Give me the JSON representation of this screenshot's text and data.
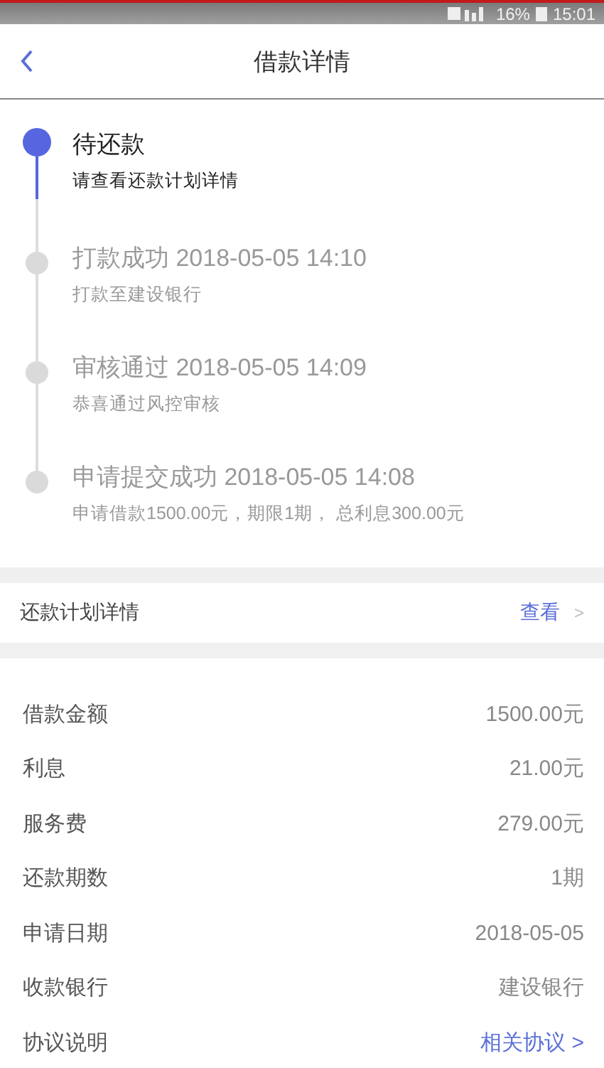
{
  "status_bar": {
    "battery": "16%",
    "time": "15:01"
  },
  "header": {
    "title": "借款详情"
  },
  "timeline": [
    {
      "title": "待还款",
      "description": "请查看还款计划详情",
      "selected": true
    },
    {
      "title": "打款成功 2018-05-05 14:10",
      "description": "打款至建设银行",
      "selected": false
    },
    {
      "title": "审核通过 2018-05-05 14:09",
      "description": "恭喜通过风控审核",
      "selected": false
    },
    {
      "title": "申请提交成功 2018-05-05 14:08",
      "description": "申请借款1500.00元，期限1期， 总利息300.00元",
      "selected": false
    }
  ],
  "plan_row": {
    "label": "还款计划详情",
    "link": "查看",
    "chevron": ">"
  },
  "details": [
    {
      "label": "借款金额",
      "value": "1500.00元",
      "kind": "value"
    },
    {
      "label": "利息",
      "value": "21.00元",
      "kind": "value"
    },
    {
      "label": "服务费",
      "value": "279.00元",
      "kind": "value"
    },
    {
      "label": "还款期数",
      "value": "1期",
      "kind": "value"
    },
    {
      "label": "申请日期",
      "value": "2018-05-05",
      "kind": "value"
    },
    {
      "label": "收款银行",
      "value": "建设银行",
      "kind": "value"
    },
    {
      "label": "协议说明",
      "value": "相关协议 >",
      "kind": "link"
    }
  ]
}
